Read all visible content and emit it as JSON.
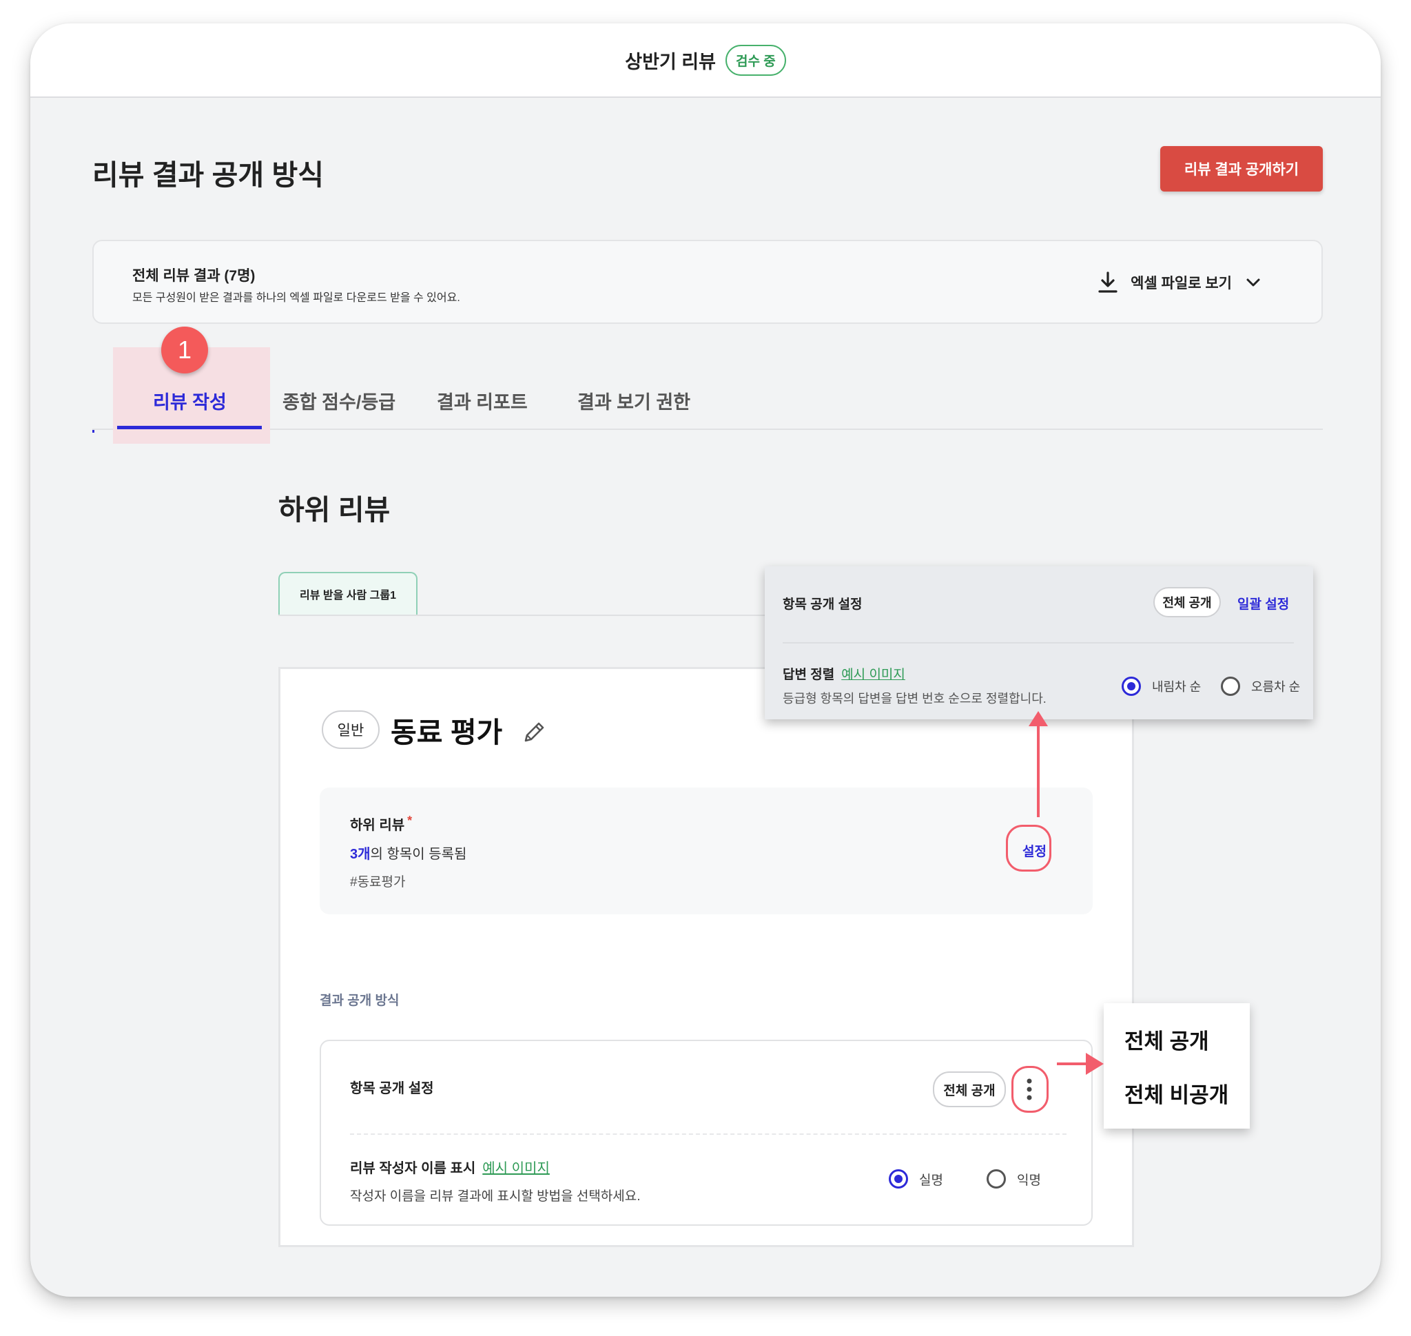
{
  "topbar": {
    "title": "상반기 리뷰",
    "status_badge": "검수 중"
  },
  "page": {
    "title": "리뷰 결과 공개 방식",
    "publish_button": "리뷰 결과 공개하기"
  },
  "summary": {
    "title": "전체 리뷰 결과 (7명)",
    "description": "모든 구성원이 받은 결과를 하나의 엑셀 파일로 다운로드 받을 수 있어요.",
    "excel_label": "엑셀 파일로 보기"
  },
  "step_badge": "1",
  "tabs": [
    {
      "label": "리뷰 작성",
      "active": true
    },
    {
      "label": "종합 점수/등급",
      "active": false
    },
    {
      "label": "결과 리포트",
      "active": false
    },
    {
      "label": "결과 보기 권한",
      "active": false
    }
  ],
  "section": {
    "title": "하위 리뷰",
    "group_tab": "리뷰 받을 사람 그룹1"
  },
  "card": {
    "type_pill": "일반",
    "title": "동료 평가",
    "item": {
      "title": "하위 리뷰",
      "required_mark": "*",
      "count_value": "3개",
      "count_suffix": "의 항목이 등록됨",
      "tag": "#동료평가",
      "settings_link": "설정"
    },
    "result_label": "결과 공개 방식",
    "visibility": {
      "title": "항목 공개 설정",
      "state_pill": "전체 공개",
      "name_title": "리뷰 작성자 이름 표시",
      "example_link": "예시 이미지",
      "name_desc": "작성자 이름을 리뷰 결과에 표시할 방법을 선택하세요.",
      "options": [
        {
          "label": "실명",
          "selected": true
        },
        {
          "label": "익명",
          "selected": false
        }
      ]
    }
  },
  "popover": {
    "title": "항목 공개 설정",
    "state_pill": "전체 공개",
    "bulk_link": "일괄 설정",
    "sort_title": "답변 정렬",
    "example_link": "예시 이미지",
    "sort_desc": "등급형 항목의 답변을 답변 번호 순으로 정렬합니다.",
    "options": [
      {
        "label": "내림차 순",
        "selected": true
      },
      {
        "label": "오름차 순",
        "selected": false
      }
    ]
  },
  "dropdown": {
    "items": [
      "전체 공개",
      "전체 비공개"
    ]
  },
  "colors": {
    "accent": "#2d2ad8",
    "danger": "#d94b42",
    "highlight": "#f25d6c",
    "success": "#2e9a55"
  }
}
